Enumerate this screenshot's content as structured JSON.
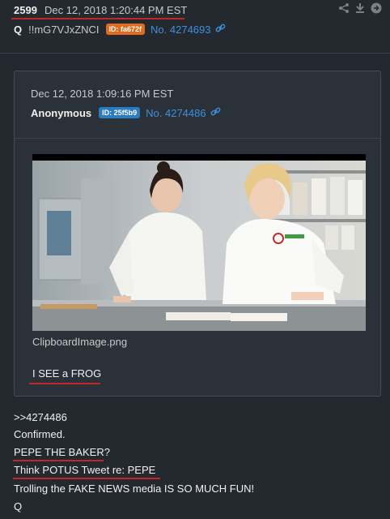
{
  "post": {
    "number": "2599",
    "date": "Dec 12, 2018 1:20:44 PM EST",
    "author": "Q",
    "tripcode": "!!mG7VJxZNCI",
    "id_badge": "ID: fa672f",
    "post_no": "No. 4274693",
    "link_icon": "link-icon"
  },
  "actions": {
    "icons": [
      "share-icon",
      "download-icon",
      "forward-icon"
    ]
  },
  "quoted": {
    "date": "Dec 12, 2018 1:09:16 PM EST",
    "author": "Anonymous",
    "id_badge": "ID: 25f5b9",
    "post_no": "No. 4274486",
    "filename": "ClipboardImage.png",
    "text": "I SEE a FROG",
    "image_description_icon": "photo-two-chefs"
  },
  "body": [
    ">>4274486",
    "Confirmed.",
    "PEPE THE BAKER?",
    "Think POTUS Tweet re: PEPE",
    "Trolling the FAKE NEWS media IS SO MUCH FUN!",
    "Q"
  ],
  "colors": {
    "background": "#24292f",
    "underline": "#c0262a",
    "link": "#3d8fe0",
    "badge_orange": "#e06a1e",
    "badge_blue": "#2a7cc0"
  }
}
